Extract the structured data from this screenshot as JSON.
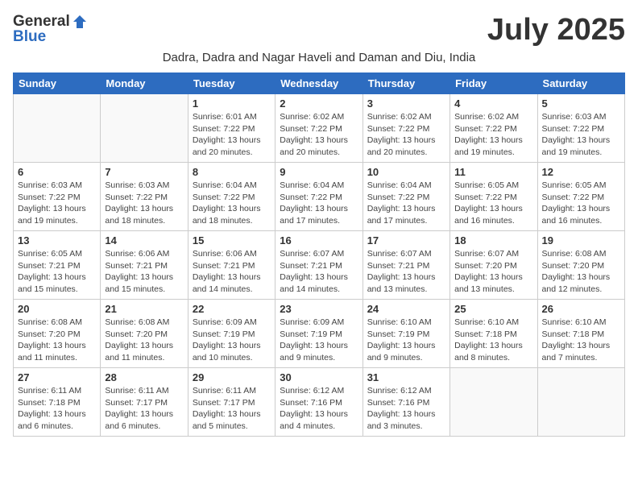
{
  "logo": {
    "general": "General",
    "blue": "Blue"
  },
  "title": "July 2025",
  "subtitle": "Dadra, Dadra and Nagar Haveli and Daman and Diu, India",
  "weekdays": [
    "Sunday",
    "Monday",
    "Tuesday",
    "Wednesday",
    "Thursday",
    "Friday",
    "Saturday"
  ],
  "weeks": [
    [
      {
        "day": "",
        "info": ""
      },
      {
        "day": "",
        "info": ""
      },
      {
        "day": "1",
        "info": "Sunrise: 6:01 AM\nSunset: 7:22 PM\nDaylight: 13 hours and 20 minutes."
      },
      {
        "day": "2",
        "info": "Sunrise: 6:02 AM\nSunset: 7:22 PM\nDaylight: 13 hours and 20 minutes."
      },
      {
        "day": "3",
        "info": "Sunrise: 6:02 AM\nSunset: 7:22 PM\nDaylight: 13 hours and 20 minutes."
      },
      {
        "day": "4",
        "info": "Sunrise: 6:02 AM\nSunset: 7:22 PM\nDaylight: 13 hours and 19 minutes."
      },
      {
        "day": "5",
        "info": "Sunrise: 6:03 AM\nSunset: 7:22 PM\nDaylight: 13 hours and 19 minutes."
      }
    ],
    [
      {
        "day": "6",
        "info": "Sunrise: 6:03 AM\nSunset: 7:22 PM\nDaylight: 13 hours and 19 minutes."
      },
      {
        "day": "7",
        "info": "Sunrise: 6:03 AM\nSunset: 7:22 PM\nDaylight: 13 hours and 18 minutes."
      },
      {
        "day": "8",
        "info": "Sunrise: 6:04 AM\nSunset: 7:22 PM\nDaylight: 13 hours and 18 minutes."
      },
      {
        "day": "9",
        "info": "Sunrise: 6:04 AM\nSunset: 7:22 PM\nDaylight: 13 hours and 17 minutes."
      },
      {
        "day": "10",
        "info": "Sunrise: 6:04 AM\nSunset: 7:22 PM\nDaylight: 13 hours and 17 minutes."
      },
      {
        "day": "11",
        "info": "Sunrise: 6:05 AM\nSunset: 7:22 PM\nDaylight: 13 hours and 16 minutes."
      },
      {
        "day": "12",
        "info": "Sunrise: 6:05 AM\nSunset: 7:22 PM\nDaylight: 13 hours and 16 minutes."
      }
    ],
    [
      {
        "day": "13",
        "info": "Sunrise: 6:05 AM\nSunset: 7:21 PM\nDaylight: 13 hours and 15 minutes."
      },
      {
        "day": "14",
        "info": "Sunrise: 6:06 AM\nSunset: 7:21 PM\nDaylight: 13 hours and 15 minutes."
      },
      {
        "day": "15",
        "info": "Sunrise: 6:06 AM\nSunset: 7:21 PM\nDaylight: 13 hours and 14 minutes."
      },
      {
        "day": "16",
        "info": "Sunrise: 6:07 AM\nSunset: 7:21 PM\nDaylight: 13 hours and 14 minutes."
      },
      {
        "day": "17",
        "info": "Sunrise: 6:07 AM\nSunset: 7:21 PM\nDaylight: 13 hours and 13 minutes."
      },
      {
        "day": "18",
        "info": "Sunrise: 6:07 AM\nSunset: 7:20 PM\nDaylight: 13 hours and 13 minutes."
      },
      {
        "day": "19",
        "info": "Sunrise: 6:08 AM\nSunset: 7:20 PM\nDaylight: 13 hours and 12 minutes."
      }
    ],
    [
      {
        "day": "20",
        "info": "Sunrise: 6:08 AM\nSunset: 7:20 PM\nDaylight: 13 hours and 11 minutes."
      },
      {
        "day": "21",
        "info": "Sunrise: 6:08 AM\nSunset: 7:20 PM\nDaylight: 13 hours and 11 minutes."
      },
      {
        "day": "22",
        "info": "Sunrise: 6:09 AM\nSunset: 7:19 PM\nDaylight: 13 hours and 10 minutes."
      },
      {
        "day": "23",
        "info": "Sunrise: 6:09 AM\nSunset: 7:19 PM\nDaylight: 13 hours and 9 minutes."
      },
      {
        "day": "24",
        "info": "Sunrise: 6:10 AM\nSunset: 7:19 PM\nDaylight: 13 hours and 9 minutes."
      },
      {
        "day": "25",
        "info": "Sunrise: 6:10 AM\nSunset: 7:18 PM\nDaylight: 13 hours and 8 minutes."
      },
      {
        "day": "26",
        "info": "Sunrise: 6:10 AM\nSunset: 7:18 PM\nDaylight: 13 hours and 7 minutes."
      }
    ],
    [
      {
        "day": "27",
        "info": "Sunrise: 6:11 AM\nSunset: 7:18 PM\nDaylight: 13 hours and 6 minutes."
      },
      {
        "day": "28",
        "info": "Sunrise: 6:11 AM\nSunset: 7:17 PM\nDaylight: 13 hours and 6 minutes."
      },
      {
        "day": "29",
        "info": "Sunrise: 6:11 AM\nSunset: 7:17 PM\nDaylight: 13 hours and 5 minutes."
      },
      {
        "day": "30",
        "info": "Sunrise: 6:12 AM\nSunset: 7:16 PM\nDaylight: 13 hours and 4 minutes."
      },
      {
        "day": "31",
        "info": "Sunrise: 6:12 AM\nSunset: 7:16 PM\nDaylight: 13 hours and 3 minutes."
      },
      {
        "day": "",
        "info": ""
      },
      {
        "day": "",
        "info": ""
      }
    ]
  ]
}
